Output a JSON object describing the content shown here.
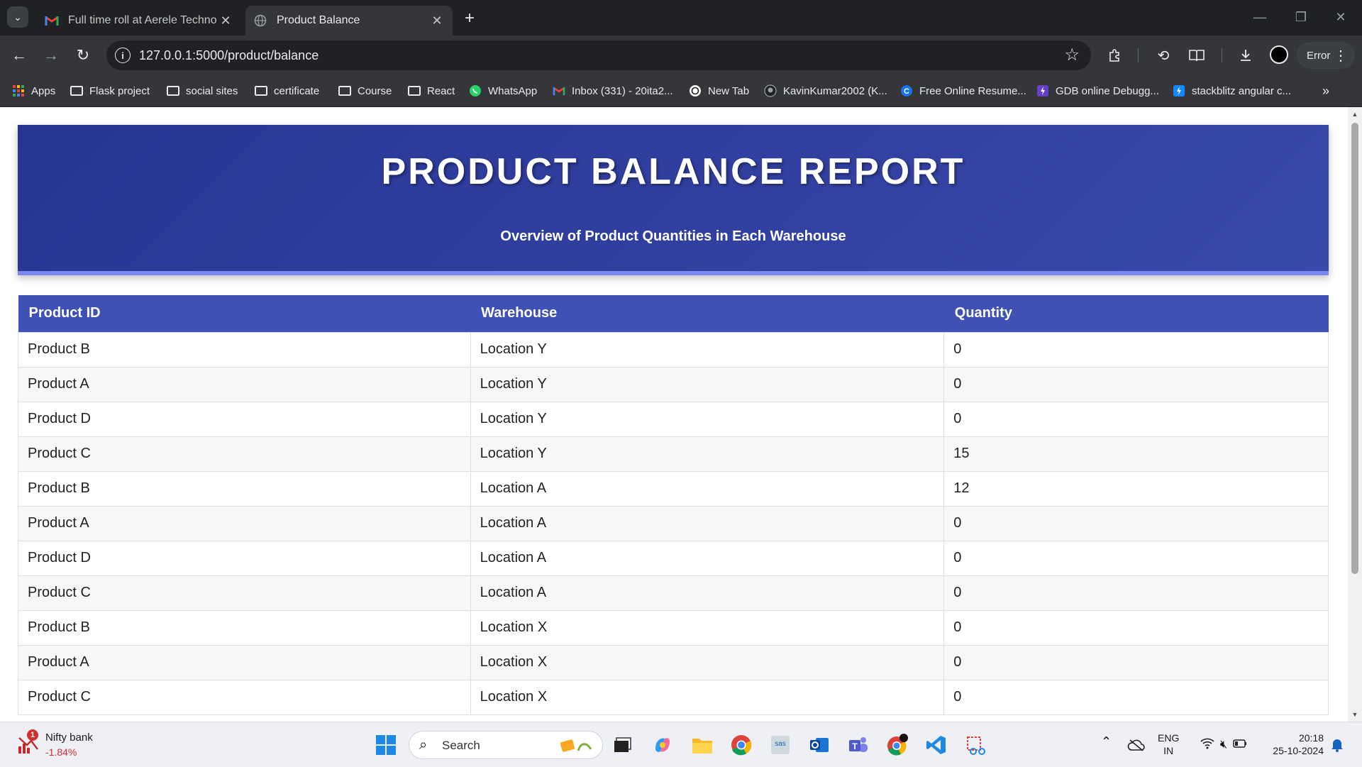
{
  "browser": {
    "tabs": [
      {
        "title": "Full time roll at Aerele Technolo",
        "active": false
      },
      {
        "title": "Product Balance",
        "active": true
      }
    ],
    "url": "127.0.0.1:5000/product/balance",
    "error_label": "Error",
    "bookmarks": [
      {
        "label": "Apps",
        "icon": "apps-grid-icon"
      },
      {
        "label": "Flask project",
        "icon": "folder-icon"
      },
      {
        "label": "social sites",
        "icon": "folder-icon"
      },
      {
        "label": "certificate",
        "icon": "folder-icon"
      },
      {
        "label": "Course",
        "icon": "folder-icon"
      },
      {
        "label": "React",
        "icon": "folder-icon"
      },
      {
        "label": "WhatsApp",
        "icon": "whatsapp-icon"
      },
      {
        "label": "Inbox (331) - 20ita2...",
        "icon": "gmail-icon"
      },
      {
        "label": "New Tab",
        "icon": "chatgpt-icon"
      },
      {
        "label": "KavinKumar2002 (K...",
        "icon": "github-icon"
      },
      {
        "label": "Free Online Resume...",
        "icon": "resume-icon"
      },
      {
        "label": "GDB online Debugg...",
        "icon": "gdb-icon"
      },
      {
        "label": "stackblitz angular c...",
        "icon": "stackblitz-icon"
      }
    ]
  },
  "page": {
    "title": "PRODUCT BALANCE REPORT",
    "subtitle": "Overview of Product Quantities in Each Warehouse",
    "table": {
      "headers": [
        "Product ID",
        "Warehouse",
        "Quantity"
      ],
      "rows": [
        [
          "Product B",
          "Location Y",
          "0"
        ],
        [
          "Product A",
          "Location Y",
          "0"
        ],
        [
          "Product D",
          "Location Y",
          "0"
        ],
        [
          "Product C",
          "Location Y",
          "15"
        ],
        [
          "Product B",
          "Location A",
          "12"
        ],
        [
          "Product A",
          "Location A",
          "0"
        ],
        [
          "Product D",
          "Location A",
          "0"
        ],
        [
          "Product C",
          "Location A",
          "0"
        ],
        [
          "Product B",
          "Location X",
          "0"
        ],
        [
          "Product A",
          "Location X",
          "0"
        ],
        [
          "Product C",
          "Location X",
          "0"
        ]
      ]
    }
  },
  "taskbar": {
    "widget_title": "Nifty bank",
    "widget_value": "-1.84%",
    "widget_badge": "1",
    "search_label": "Search",
    "lang_top": "ENG",
    "lang_bottom": "IN",
    "time": "20:18",
    "date": "25-10-2024"
  },
  "colors": {
    "header_gradient_start": "#283593",
    "header_gradient_end": "#3949ab",
    "table_header": "#3f51b5",
    "widget_value": "#d32f2f"
  }
}
